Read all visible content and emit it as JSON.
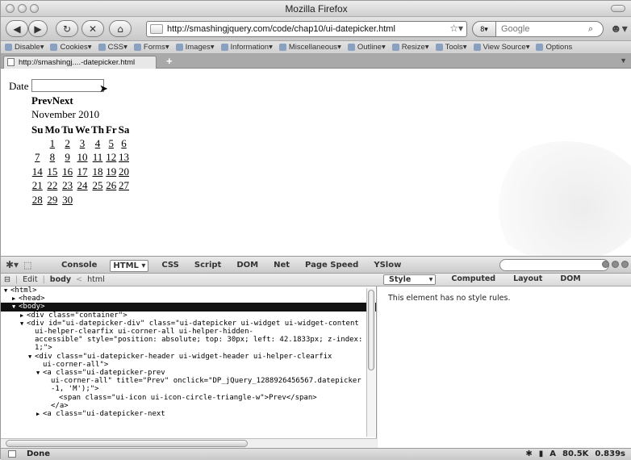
{
  "window": {
    "title": "Mozilla Firefox"
  },
  "nav": {
    "back_icon": "back-arrow-icon",
    "forward_icon": "forward-arrow-icon",
    "url": "http://smashingjquery.com/code/chap10/ui-datepicker.html",
    "search_placeholder": "Google"
  },
  "devbar": {
    "items": [
      "Disable",
      "Cookies",
      "CSS",
      "Forms",
      "Images",
      "Information",
      "Miscellaneous",
      "Outline",
      "Resize",
      "Tools",
      "View Source",
      "Options"
    ]
  },
  "tab": {
    "label": "http://smashingj....-datepicker.html",
    "new_tab": "+"
  },
  "page": {
    "date_label": "Date",
    "prev": "Prev",
    "next": "Next",
    "month": "November 2010",
    "weekdays": [
      "Su",
      "Mo",
      "Tu",
      "We",
      "Th",
      "Fr",
      "Sa"
    ],
    "weeks": [
      [
        "",
        "1",
        "2",
        "3",
        "4",
        "5",
        "6"
      ],
      [
        "7",
        "8",
        "9",
        "10",
        "11",
        "12",
        "13"
      ],
      [
        "14",
        "15",
        "16",
        "17",
        "18",
        "19",
        "20"
      ],
      [
        "21",
        "22",
        "23",
        "24",
        "25",
        "26",
        "27"
      ],
      [
        "28",
        "29",
        "30",
        "",
        "",
        "",
        ""
      ]
    ]
  },
  "firebug": {
    "tabs": [
      "Console",
      "HTML",
      "CSS",
      "Script",
      "DOM",
      "Net",
      "Page Speed",
      "YSlow"
    ],
    "active_tab": "HTML",
    "edit": "Edit",
    "breadcrumb": [
      "body",
      "html"
    ],
    "side_tabs": [
      "Style",
      "Computed",
      "Layout",
      "DOM"
    ],
    "style_message": "This element has no style rules.",
    "html_lines": [
      {
        "indent": 0,
        "twisty": "▼",
        "text": "<html>"
      },
      {
        "indent": 1,
        "twisty": "▶",
        "text": "<head>"
      },
      {
        "indent": 1,
        "twisty": "▼",
        "text": "<body>",
        "selected": true
      },
      {
        "indent": 2,
        "twisty": "▶",
        "text": "<div class=\"container\">"
      },
      {
        "indent": 2,
        "twisty": "▼",
        "text": "<div id=\"ui-datepicker-div\" class=\"ui-datepicker ui-widget ui-widget-content"
      },
      {
        "indent": 3,
        "twisty": "",
        "text": "ui-helper-clearfix ui-corner-all ui-helper-hidden-"
      },
      {
        "indent": 3,
        "twisty": "",
        "text": "accessible\" style=\"position: absolute; top: 30px; left: 42.1833px; z-index:"
      },
      {
        "indent": 3,
        "twisty": "",
        "text": "1;\">"
      },
      {
        "indent": 3,
        "twisty": "▼",
        "text": "<div class=\"ui-datepicker-header ui-widget-header ui-helper-clearfix"
      },
      {
        "indent": 4,
        "twisty": "",
        "text": "ui-corner-all\">"
      },
      {
        "indent": 4,
        "twisty": "▼",
        "text": "<a class=\"ui-datepicker-prev"
      },
      {
        "indent": 5,
        "twisty": "",
        "text": "ui-corner-all\" title=\"Prev\" onclick=\"DP_jQuery_1288926456567.datepicker"
      },
      {
        "indent": 5,
        "twisty": "",
        "text": "-1, 'M');\">"
      },
      {
        "indent": 6,
        "twisty": "",
        "text": "<span class=\"ui-icon ui-icon-circle-triangle-w\">Prev</span>"
      },
      {
        "indent": 5,
        "twisty": "",
        "text": "</a>"
      },
      {
        "indent": 4,
        "twisty": "▶",
        "text": "<a class=\"ui-datepicker-next"
      }
    ]
  },
  "status": {
    "text": "Done",
    "size": "80.5K",
    "time": "0.839s",
    "a_label": "A"
  }
}
